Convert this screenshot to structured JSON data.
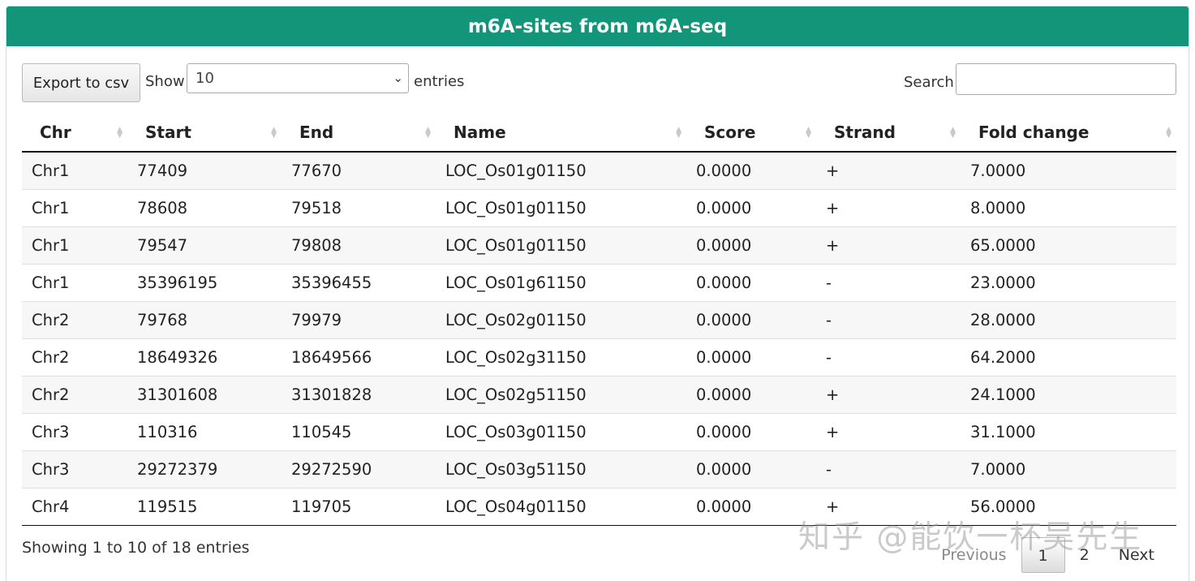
{
  "title": "m6A-sites from m6A-seq",
  "toolbar": {
    "export_label": "Export to csv",
    "show_label": "Show",
    "length_value": "10",
    "entries_label": "entries",
    "search_label": "Search:",
    "search_value": ""
  },
  "table": {
    "columns": [
      "Chr",
      "Start",
      "End",
      "Name",
      "Score",
      "Strand",
      "Fold change"
    ],
    "rows": [
      [
        "Chr1",
        "77409",
        "77670",
        "LOC_Os01g01150",
        "0.0000",
        "+",
        "7.0000"
      ],
      [
        "Chr1",
        "78608",
        "79518",
        "LOC_Os01g01150",
        "0.0000",
        "+",
        "8.0000"
      ],
      [
        "Chr1",
        "79547",
        "79808",
        "LOC_Os01g01150",
        "0.0000",
        "+",
        "65.0000"
      ],
      [
        "Chr1",
        "35396195",
        "35396455",
        "LOC_Os01g61150",
        "0.0000",
        "-",
        "23.0000"
      ],
      [
        "Chr2",
        "79768",
        "79979",
        "LOC_Os02g01150",
        "0.0000",
        "-",
        "28.0000"
      ],
      [
        "Chr2",
        "18649326",
        "18649566",
        "LOC_Os02g31150",
        "0.0000",
        "-",
        "64.2000"
      ],
      [
        "Chr2",
        "31301608",
        "31301828",
        "LOC_Os02g51150",
        "0.0000",
        "+",
        "24.1000"
      ],
      [
        "Chr3",
        "110316",
        "110545",
        "LOC_Os03g01150",
        "0.0000",
        "+",
        "31.1000"
      ],
      [
        "Chr3",
        "29272379",
        "29272590",
        "LOC_Os03g51150",
        "0.0000",
        "-",
        "7.0000"
      ],
      [
        "Chr4",
        "119515",
        "119705",
        "LOC_Os04g01150",
        "0.0000",
        "+",
        "56.0000"
      ]
    ]
  },
  "footer": {
    "info": "Showing 1 to 10 of 18 entries",
    "previous": "Previous",
    "page1": "1",
    "page2": "2",
    "next": "Next"
  },
  "watermark": "知乎 @能饮一杯吴先生",
  "colors": {
    "header_bg": "#13957a"
  }
}
